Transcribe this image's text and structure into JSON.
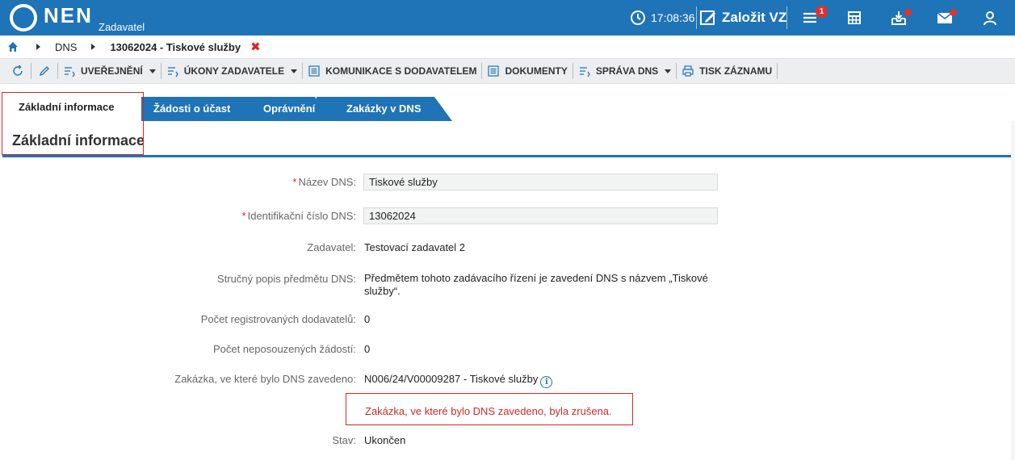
{
  "header": {
    "logo_text": "NEN",
    "subtitle": "Zadavatel",
    "time": "17:08:36",
    "create_label": "Založit VZ",
    "notification_count": "1",
    "icons": [
      "clock-icon",
      "edit-icon",
      "menu-icon",
      "calculator-icon",
      "inbox-icon",
      "mail-icon",
      "user-icon"
    ],
    "brand_color": "#1f73b7",
    "alert_color": "#e0312f"
  },
  "breadcrumb": {
    "items": [
      "DNS",
      "13062024 - Tiskové služby"
    ],
    "close_symbol": "✖"
  },
  "toolbar": {
    "items": [
      {
        "label": "UVEŘEJNĚNÍ"
      },
      {
        "label": "ÚKONY ZADAVATELE"
      },
      {
        "label": "KOMUNIKACE S DODAVATELEM"
      },
      {
        "label": "DOKUMENTY"
      },
      {
        "label": "SPRÁVA DNS"
      },
      {
        "label": "TISK ZÁZNAMU"
      }
    ]
  },
  "tabs": [
    {
      "label": "Základní informace",
      "active": true
    },
    {
      "label": "Žádosti o účast"
    },
    {
      "label": "Oprávnění"
    },
    {
      "label": "Zakázky v DNS"
    }
  ],
  "section": {
    "title": "Základní informace"
  },
  "form": {
    "name": {
      "label": "Název DNS:",
      "value": "Tiskové služby"
    },
    "id": {
      "label": "Identifikační číslo DNS:",
      "value": "13062024"
    },
    "authority": {
      "label": "Zadavatel:",
      "value": "Testovací zadavatel 2"
    },
    "description": {
      "label": "Stručný popis předmětu DNS:",
      "value": "Předmětem tohoto zadávacího řízení je zavedení DNS s názvem „Tiskové služby“."
    },
    "registered": {
      "label": "Počet registrovaných dodavatelů:",
      "value": "0"
    },
    "unassessed": {
      "label": "Počet neposouzených žádostí:",
      "value": "0"
    },
    "contract": {
      "label": "Zakázka, ve které bylo DNS zavedeno:",
      "value": "N006/24/V00009287 - Tiskové služby"
    },
    "warning": "Zakázka, ve které bylo DNS zavedeno, byla zrušena.",
    "status": {
      "label": "Stav:",
      "value": "Ukončen"
    }
  }
}
